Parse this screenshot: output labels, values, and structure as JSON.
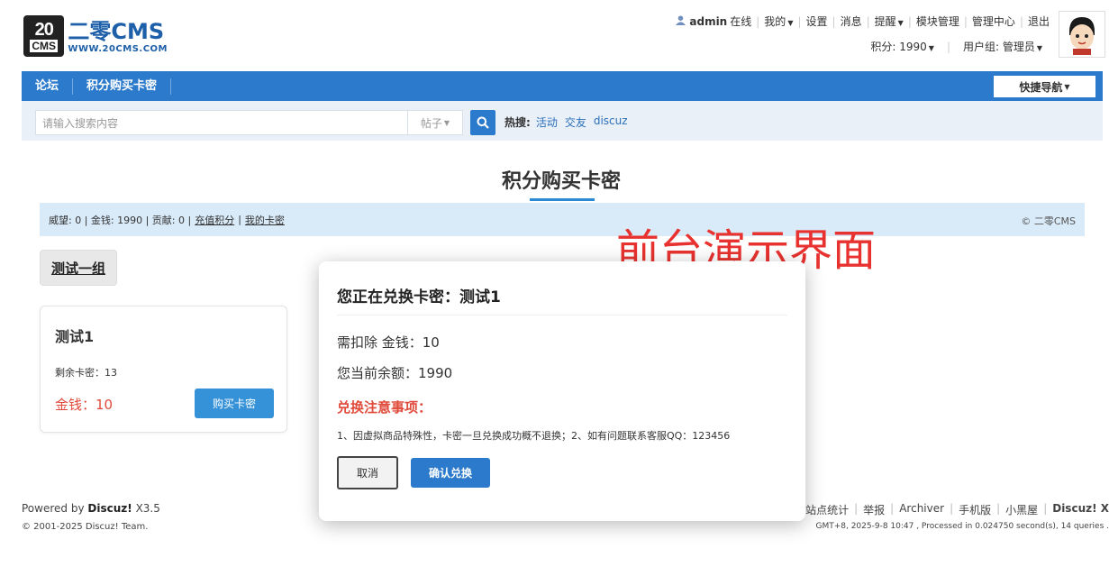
{
  "logo": {
    "box_line1": "20",
    "box_line2": "CMS",
    "title": "二零CMS",
    "url": "WWW.20CMS.COM"
  },
  "topbar": {
    "username": "admin",
    "status": "在线",
    "items": [
      "我的",
      "设置",
      "消息",
      "提醒",
      "模块管理",
      "管理中心",
      "退出"
    ],
    "points": "积分: 1990",
    "usergroup": "用户组: 管理员"
  },
  "nav": {
    "items": [
      "论坛",
      "积分购买卡密"
    ],
    "quick_nav": "快捷导航"
  },
  "search": {
    "placeholder": "请输入搜索内容",
    "type": "帖子",
    "hot_label": "热搜:",
    "hot_links": [
      "活动",
      "交友",
      "discuz"
    ]
  },
  "page": {
    "title": "积分购买卡密"
  },
  "infobar": {
    "stats": "威望: 0 | 金钱: 1990 | 贡献: 0 |",
    "recharge": "充值积分",
    "pipe": "|",
    "my_cards": "我的卡密",
    "copyright": "© 二零CMS"
  },
  "watermark": "前台演示界面",
  "group_tab": "测试一组",
  "card": {
    "title": "测试1",
    "remain": "剩余卡密：13",
    "price": "金钱：10",
    "buy_label": "购买卡密"
  },
  "modal": {
    "title": "您正在兑换卡密：测试1",
    "deduct": "需扣除 金钱：10",
    "balance": "您当前余额：1990",
    "notice_title": "兑换注意事项：",
    "notice": "1、因虚拟商品特殊性，卡密一旦兑换成功概不退换；2、如有问题联系客服QQ：123456",
    "cancel": "取消",
    "confirm": "确认兑换"
  },
  "footer": {
    "powered_prefix": "Powered by",
    "powered_brand": "Discuz!",
    "powered_version": "X3.5",
    "copyright": "© 2001-2025 Discuz! Team.",
    "links": [
      "站点统计",
      "举报",
      "Archiver",
      "手机版",
      "小黑屋"
    ],
    "brand": "Discuz! X",
    "stats": "GMT+8, 2025-9-8 10:47 , Processed in 0.024750 second(s), 14 queries ."
  },
  "colors": {
    "primary": "#2b7acb",
    "accent_red": "#e14b3b",
    "info_bg": "#d9eaf9"
  }
}
